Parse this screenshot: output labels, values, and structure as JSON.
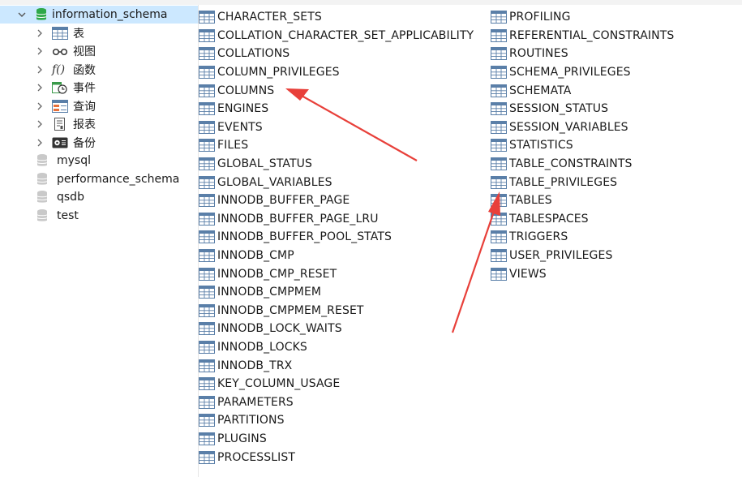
{
  "sidebar": {
    "databases": [
      {
        "name": "information_schema",
        "expanded": true,
        "selected": true
      },
      {
        "name": "mysql"
      },
      {
        "name": "performance_schema"
      },
      {
        "name": "qsdb"
      },
      {
        "name": "test"
      }
    ],
    "categories": [
      {
        "label": "表",
        "icon": "table-icon"
      },
      {
        "label": "视图",
        "icon": "view-icon"
      },
      {
        "label": "函数",
        "icon": "function-icon"
      },
      {
        "label": "事件",
        "icon": "event-icon"
      },
      {
        "label": "查询",
        "icon": "query-icon"
      },
      {
        "label": "报表",
        "icon": "report-icon"
      },
      {
        "label": "备份",
        "icon": "backup-icon"
      }
    ]
  },
  "tables": {
    "column1": [
      "CHARACTER_SETS",
      "COLLATION_CHARACTER_SET_APPLICABILITY",
      "COLLATIONS",
      "COLUMN_PRIVILEGES",
      "COLUMNS",
      "ENGINES",
      "EVENTS",
      "FILES",
      "GLOBAL_STATUS",
      "GLOBAL_VARIABLES",
      "INNODB_BUFFER_PAGE",
      "INNODB_BUFFER_PAGE_LRU",
      "INNODB_BUFFER_POOL_STATS",
      "INNODB_CMP",
      "INNODB_CMP_RESET",
      "INNODB_CMPMEM",
      "INNODB_CMPMEM_RESET",
      "INNODB_LOCK_WAITS",
      "INNODB_LOCKS",
      "INNODB_TRX",
      "KEY_COLUMN_USAGE",
      "PARAMETERS",
      "PARTITIONS",
      "PLUGINS",
      "PROCESSLIST"
    ],
    "column2": [
      "PROFILING",
      "REFERENTIAL_CONSTRAINTS",
      "ROUTINES",
      "SCHEMA_PRIVILEGES",
      "SCHEMATA",
      "SESSION_STATUS",
      "SESSION_VARIABLES",
      "STATISTICS",
      "TABLE_CONSTRAINTS",
      "TABLE_PRIVILEGES",
      "TABLES",
      "TABLESPACES",
      "TRIGGERS",
      "USER_PRIVILEGES",
      "VIEWS"
    ]
  },
  "colors": {
    "selection": "#cce8ff",
    "arrow": "#e8403a",
    "db_icon": "#2ea84a",
    "table_icon": "#3d7fc4"
  }
}
